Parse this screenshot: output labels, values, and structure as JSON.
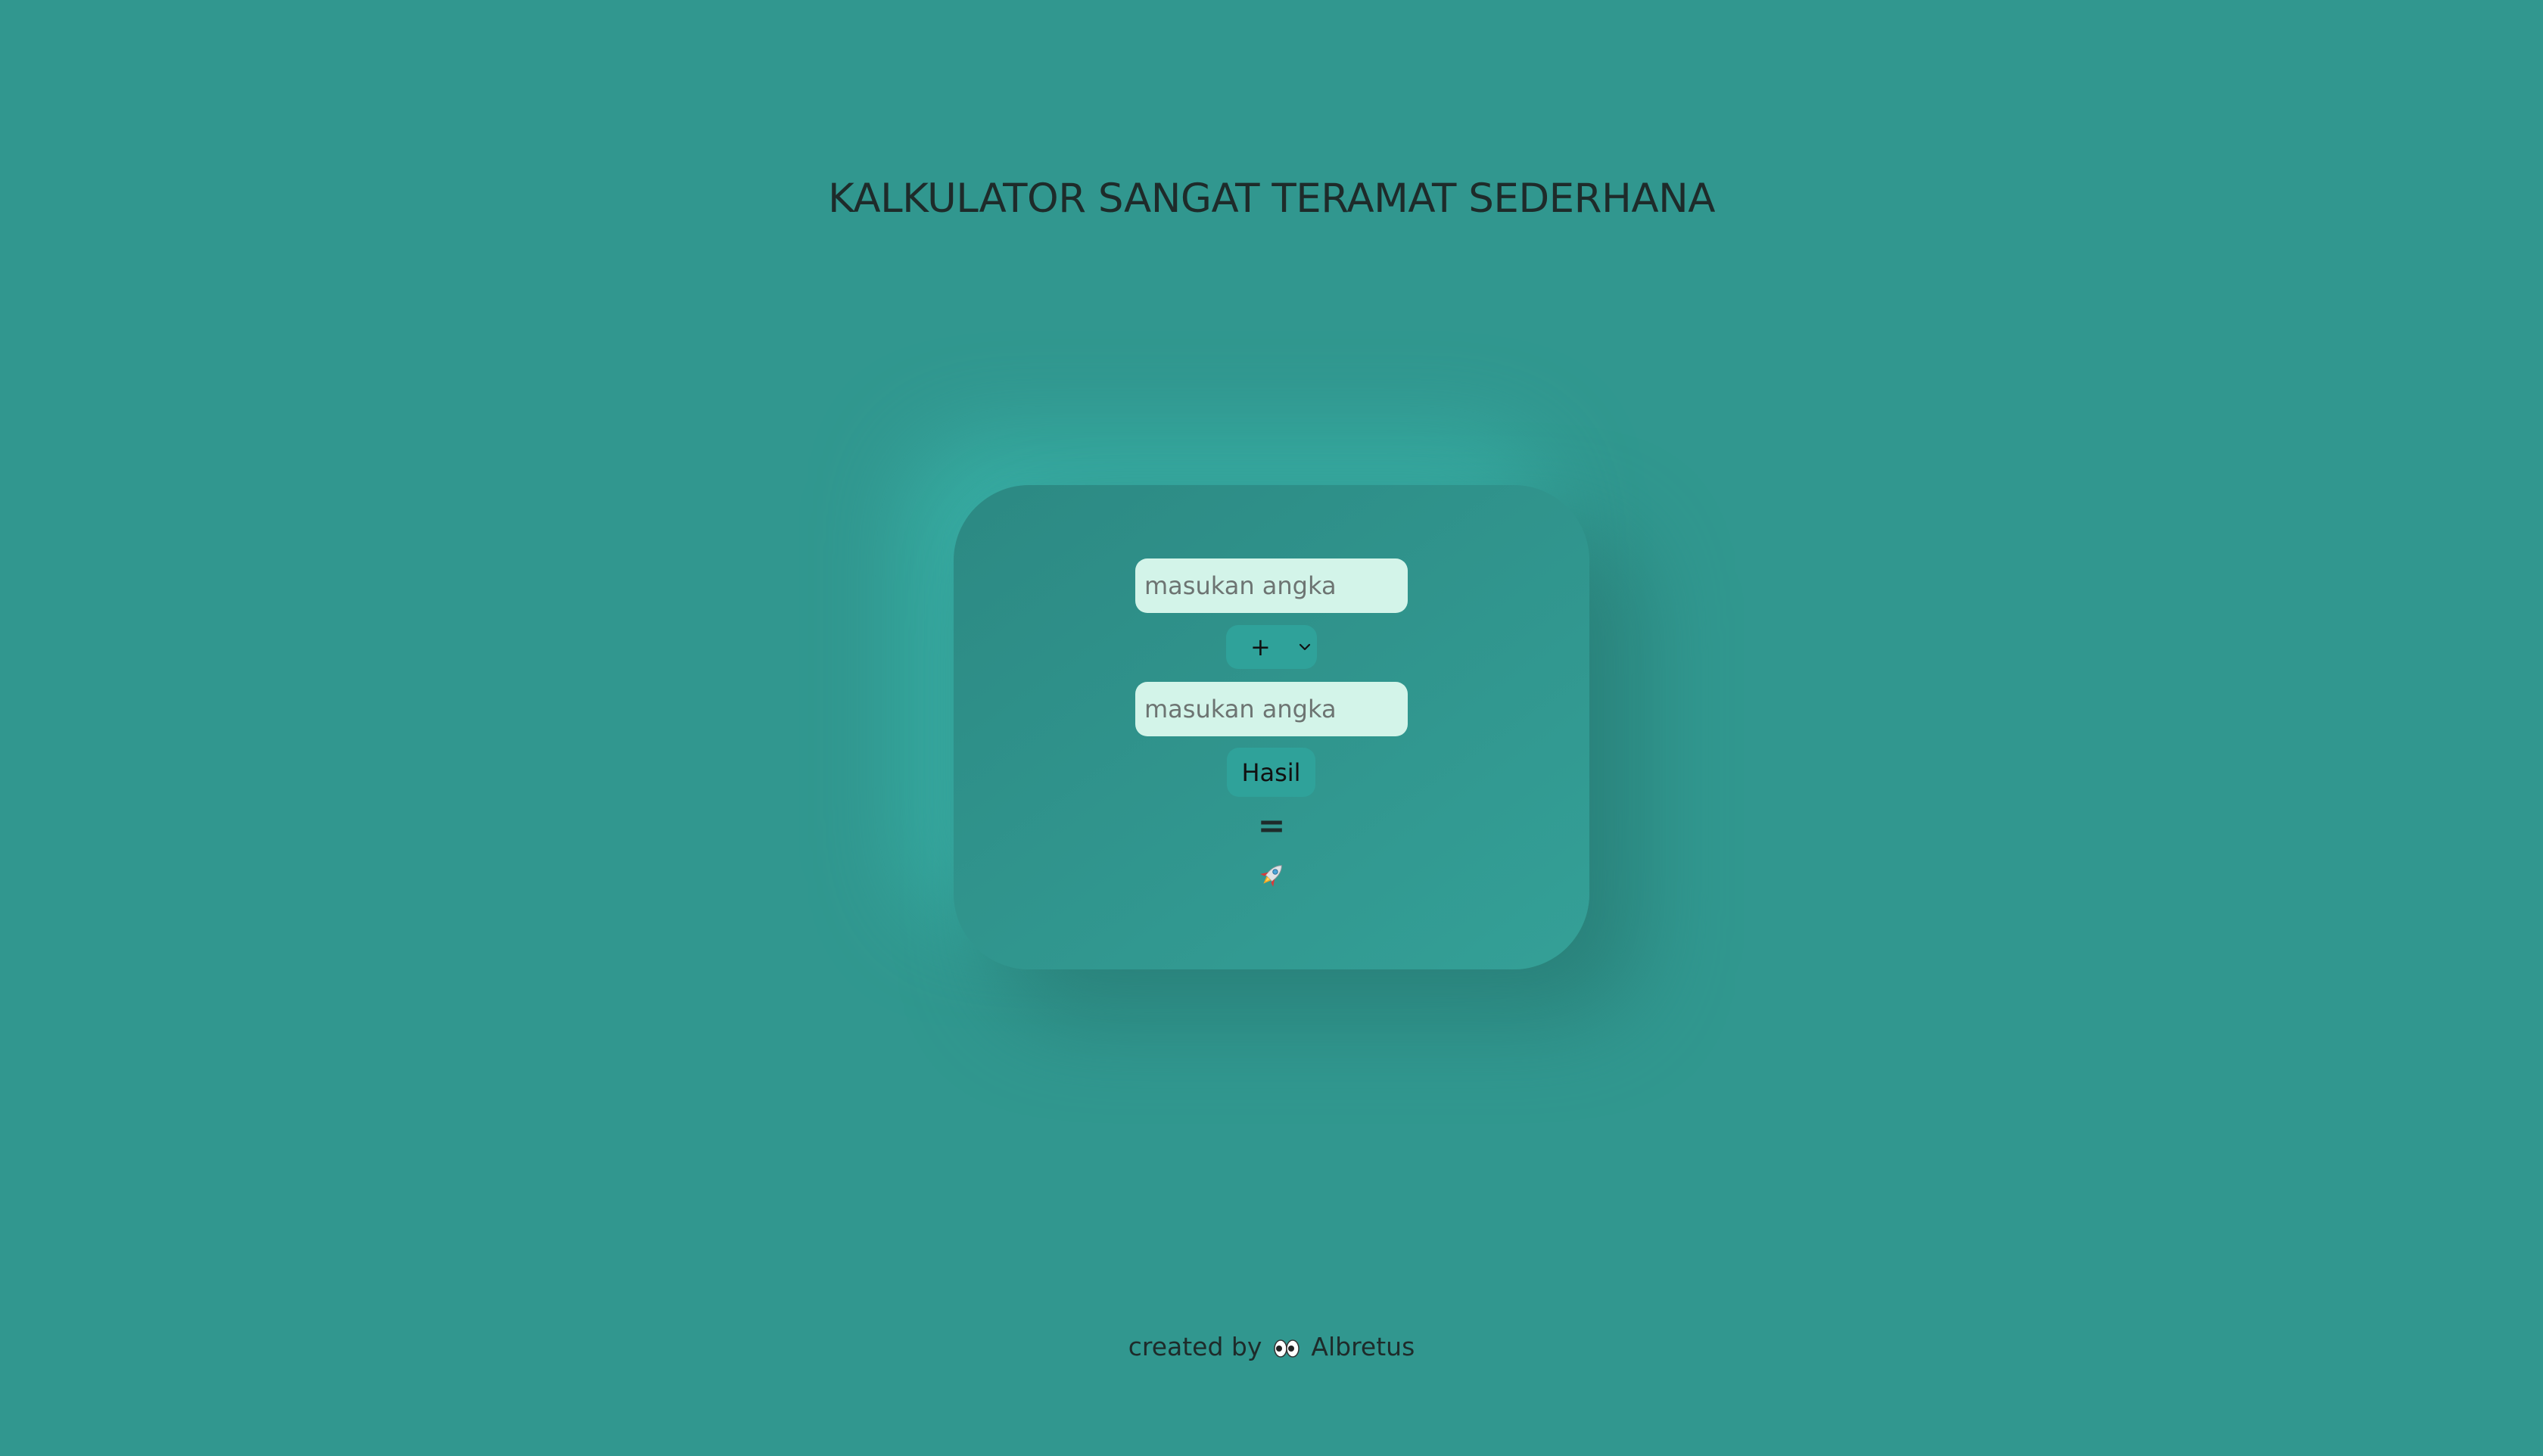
{
  "page": {
    "title": "KALKULATOR SANGAT TERAMAT SEDERHANA"
  },
  "calculator": {
    "first_input": {
      "placeholder": "masukan angka",
      "value": ""
    },
    "operator": {
      "selected": "+"
    },
    "second_input": {
      "placeholder": "masukan angka",
      "value": ""
    },
    "submit_label": "Hasil",
    "equals_sign": "=",
    "result_icon": "rocket-icon"
  },
  "footer": {
    "prefix": "created by",
    "icon": "eyes-icon",
    "author": "Albretus"
  },
  "colors": {
    "background": "#31978f",
    "card": "#31978f",
    "input_background": "#d3f4e9",
    "button_background": "#2fa29a",
    "text": "#1e2b2a"
  }
}
